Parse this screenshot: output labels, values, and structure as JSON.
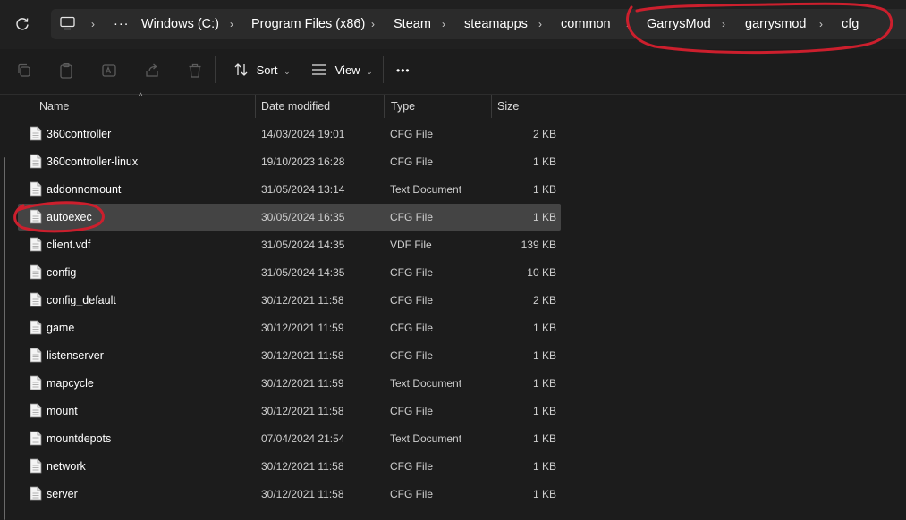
{
  "address_bar": {
    "overflow": "···",
    "crumbs": [
      "Windows (C:)",
      "Program Files (x86)",
      "Steam",
      "steamapps",
      "common",
      "GarrysMod",
      "garrysmod",
      "cfg"
    ]
  },
  "toolbar": {
    "sort_label": "Sort",
    "view_label": "View",
    "more_label": "•••"
  },
  "columns": {
    "name": "Name",
    "date": "Date modified",
    "type": "Type",
    "size": "Size"
  },
  "files": [
    {
      "name": "360controller",
      "date": "14/03/2024 19:01",
      "type": "CFG File",
      "size": "2 KB"
    },
    {
      "name": "360controller-linux",
      "date": "19/10/2023 16:28",
      "type": "CFG File",
      "size": "1 KB"
    },
    {
      "name": "addonnomount",
      "date": "31/05/2024 13:14",
      "type": "Text Document",
      "size": "1 KB"
    },
    {
      "name": "autoexec",
      "date": "30/05/2024 16:35",
      "type": "CFG File",
      "size": "1 KB"
    },
    {
      "name": "client.vdf",
      "date": "31/05/2024 14:35",
      "type": "VDF File",
      "size": "139 KB"
    },
    {
      "name": "config",
      "date": "31/05/2024 14:35",
      "type": "CFG File",
      "size": "10 KB"
    },
    {
      "name": "config_default",
      "date": "30/12/2021 11:58",
      "type": "CFG File",
      "size": "2 KB"
    },
    {
      "name": "game",
      "date": "30/12/2021 11:59",
      "type": "CFG File",
      "size": "1 KB"
    },
    {
      "name": "listenserver",
      "date": "30/12/2021 11:58",
      "type": "CFG File",
      "size": "1 KB"
    },
    {
      "name": "mapcycle",
      "date": "30/12/2021 11:59",
      "type": "Text Document",
      "size": "1 KB"
    },
    {
      "name": "mount",
      "date": "30/12/2021 11:58",
      "type": "CFG File",
      "size": "1 KB"
    },
    {
      "name": "mountdepots",
      "date": "07/04/2024 21:54",
      "type": "Text Document",
      "size": "1 KB"
    },
    {
      "name": "network",
      "date": "30/12/2021 11:58",
      "type": "CFG File",
      "size": "1 KB"
    },
    {
      "name": "server",
      "date": "30/12/2021 11:58",
      "type": "CFG File",
      "size": "1 KB"
    }
  ],
  "selected_file": "autoexec",
  "colors": {
    "background": "#1c1c1c",
    "address_box": "#2b2b2b",
    "selection": "#444444",
    "annotation": "#cc1f2d"
  },
  "icons": [
    "refresh-icon",
    "computer-icon",
    "chevron-right-icon",
    "copy-icon",
    "paste-icon",
    "rename-icon",
    "share-icon",
    "delete-icon",
    "sort-icon",
    "view-icon",
    "file-icon"
  ]
}
